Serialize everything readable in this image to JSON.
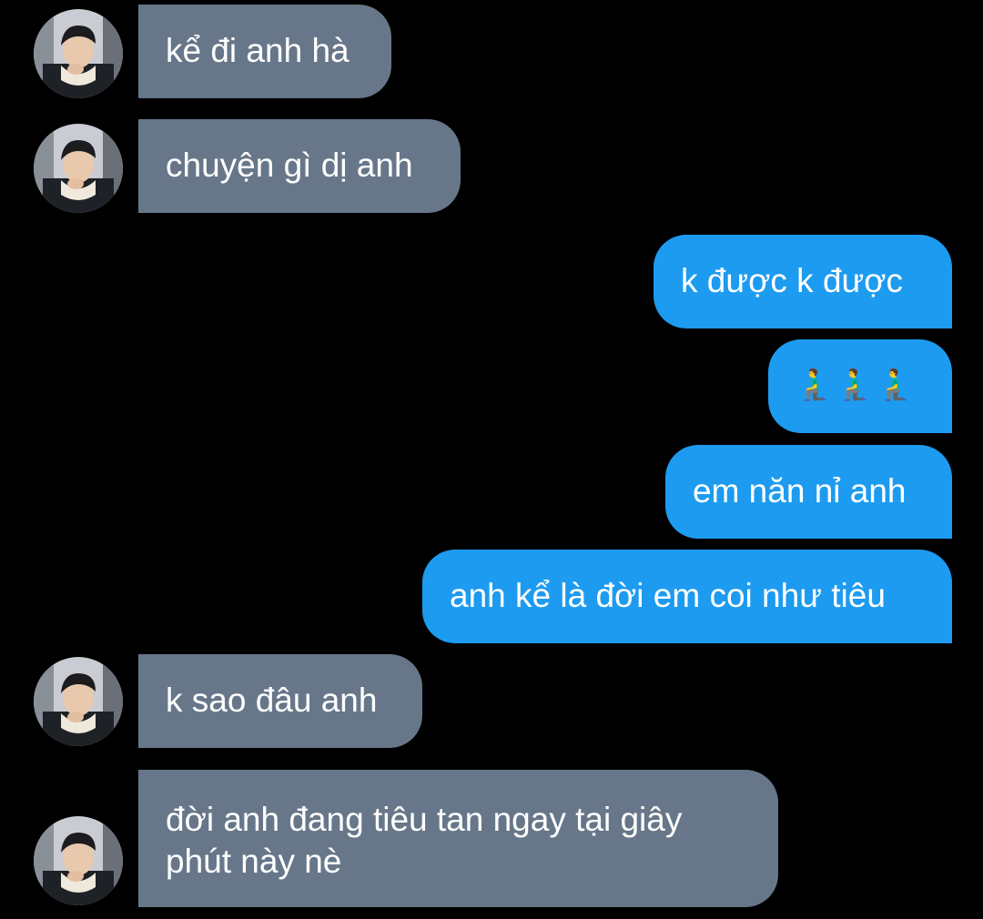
{
  "conversation": {
    "messages": [
      {
        "sender": "other",
        "text": "kể đi anh hà"
      },
      {
        "sender": "other",
        "text": "chuyện gì dị anh"
      },
      {
        "sender": "me",
        "text": "k được k được"
      },
      {
        "sender": "me",
        "text": "🧎‍♂️🧎‍♂️🧎‍♂️"
      },
      {
        "sender": "me",
        "text": "em năn nỉ anh"
      },
      {
        "sender": "me",
        "text": "anh kể là đời em coi như tiêu"
      },
      {
        "sender": "other",
        "text": "k sao đâu anh"
      },
      {
        "sender": "other",
        "text": "đời anh đang tiêu tan ngay tại giây phút này nè"
      }
    ]
  },
  "colors": {
    "background": "#000000",
    "incoming_bubble": "#677789",
    "outgoing_bubble": "#1d9bf0",
    "text": "#ffffff"
  },
  "icons": {
    "avatar": "profile-photo",
    "kneeling_emoji": "person-kneeling"
  }
}
